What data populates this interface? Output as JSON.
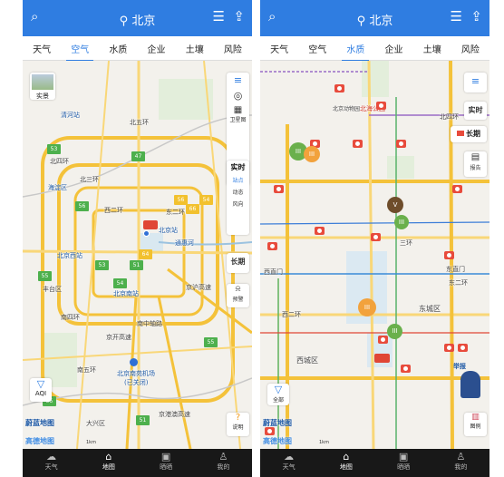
{
  "panels": [
    {
      "top": {
        "city": "北京"
      },
      "tabs": [
        "天气",
        "空气",
        "水质",
        "企业",
        "土壤",
        "风险"
      ],
      "active_tab": 1,
      "map": {
        "scene_label": "实景",
        "rings": [
          "北五环",
          "北四环",
          "北三环"
        ],
        "places": [
          "清河站",
          "海淀区",
          "北京西站",
          "北京南站",
          "丰台区",
          "南四环",
          "南五环",
          "北京南苑机场",
          "(已关闭)",
          "大兴区",
          "北京站"
        ],
        "roads": [
          "西二环",
          "东二环",
          "南中轴路",
          "京开高速",
          "京港澳高速",
          "京沪高速",
          "通惠河"
        ],
        "aqi_values": [
          "53",
          "47",
          "56",
          "66",
          "54",
          "56",
          "64",
          "53",
          "51",
          "54",
          "55",
          "55",
          "55",
          "51"
        ],
        "side_tools": [
          "卫星图"
        ],
        "realtime": {
          "title": "实时",
          "items": [
            "站点",
            "动态",
            "风向"
          ]
        },
        "longterm": "长期",
        "forecast": "预警",
        "filter_label": "AQI",
        "explain_label": "说明",
        "logo": "蔚蓝地图",
        "logo2": "高德地图",
        "scale": "1km"
      },
      "nav": [
        {
          "label": "天气",
          "icon": "cloud-icon"
        },
        {
          "label": "地图",
          "icon": "map-icon",
          "active": true
        },
        {
          "label": "晒晒",
          "icon": "photo-icon"
        },
        {
          "label": "我的",
          "icon": "user-icon"
        }
      ]
    },
    {
      "top": {
        "city": "北京"
      },
      "tabs": [
        "天气",
        "空气",
        "水质",
        "企业",
        "土壤",
        "风险"
      ],
      "active_tab": 2,
      "map": {
        "places": [
          "北京动物园",
          "北海公园",
          "北四环",
          "西直门",
          "阜成门",
          "东直门",
          "东城区",
          "西城区",
          "三环",
          "东二环",
          "西二环"
        ],
        "grades": [
          "III",
          "III",
          "V",
          "III",
          "III",
          "III"
        ],
        "side_tools": [
          "报告"
        ],
        "realtime": {
          "title": "实时"
        },
        "longterm": "长期",
        "report_label": "举报",
        "filter_label": "全部",
        "legend_label": "图例",
        "logo": "蔚蓝地图",
        "logo2": "高德地图",
        "scale": "1km"
      },
      "nav": [
        {
          "label": "天气",
          "icon": "cloud-icon"
        },
        {
          "label": "地图",
          "icon": "map-icon",
          "active": true
        },
        {
          "label": "晒晒",
          "icon": "photo-icon"
        },
        {
          "label": "我的",
          "icon": "user-icon"
        }
      ]
    }
  ],
  "colors": {
    "header": "#2f7de1",
    "aqi_good": "#4db04d",
    "aqi_ok": "#f2c12e",
    "cam": "#e84b3c",
    "grade3": "#6ab04c",
    "grade5": "#6e4d2b"
  }
}
